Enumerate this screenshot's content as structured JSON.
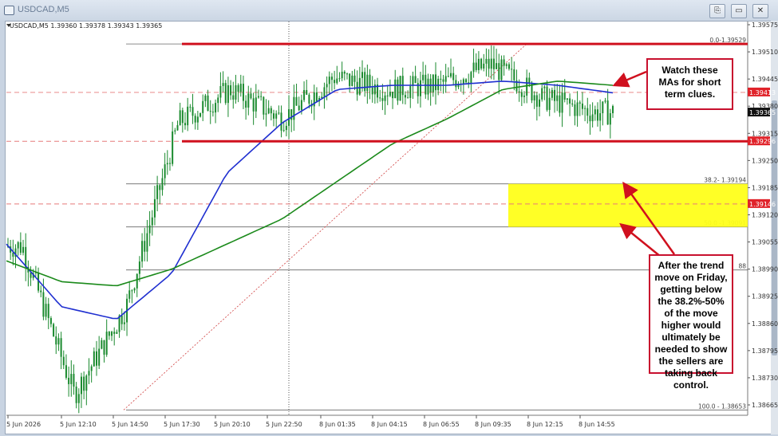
{
  "window": {
    "title": "USDCAD,M5",
    "buttons": [
      "⎘",
      "▭",
      "✕"
    ]
  },
  "symbol_info": "USDCAD,M5  1.39360 1.39378 1.39343 1.39365",
  "price_axis": {
    "ticks": [
      "1.39575",
      "1.39510",
      "1.39445",
      "1.39380",
      "1.39315",
      "1.39250",
      "1.39185",
      "1.39120",
      "1.39055",
      "1.38990",
      "1.38925",
      "1.38860",
      "1.38795",
      "1.38730",
      "1.38665"
    ],
    "tick_values": [
      1.39575,
      1.3951,
      1.39445,
      1.3938,
      1.39315,
      1.3925,
      1.39185,
      1.3912,
      1.39055,
      1.3899,
      1.38925,
      1.3886,
      1.38795,
      1.3873,
      1.38665
    ],
    "markers": [
      {
        "label": "1.39413",
        "value": 1.39413,
        "color": "#e0232a"
      },
      {
        "label": "1.39365",
        "value": 1.39365,
        "color": "#111111"
      },
      {
        "label": "1.39296",
        "value": 1.39296,
        "color": "#e0232a"
      },
      {
        "label": "1.39146",
        "value": 1.39146,
        "color": "#e0232a"
      }
    ]
  },
  "time_axis": {
    "labels": [
      "5 Jun 2026",
      "5 Jun 12:10",
      "5 Jun 14:50",
      "5 Jun 17:30",
      "5 Jun 20:10",
      "5 Jun 22:50",
      "8 Jun 01:35",
      "8 Jun 04:15",
      "8 Jun 06:55",
      "8 Jun 09:35",
      "8 Jun 12:15",
      "8 Jun 14:55"
    ]
  },
  "fibonacci": [
    {
      "label": "0.0-1.39529",
      "value": 1.39529
    },
    {
      "label": "38.2- 1.39194",
      "value": 1.39194
    },
    {
      "label": "50.0 -1.39091",
      "value": 1.39091
    },
    {
      "label": "88",
      "value": 1.38988
    },
    {
      "label": "100.0 - 1.38653",
      "value": 1.38653
    }
  ],
  "annotations": {
    "ma_note": "Watch these MAs for short term clues.",
    "fib_note": "After the trend move on Friday, getting below the 38.2%-50% of the move higher would ultimately be needed to show the sellers are taking back control."
  },
  "colors": {
    "candle": "#1a8a2e",
    "ma_blue": "#1f2fd0",
    "ma_green": "#1b8a1b",
    "resistance": "#d0101e",
    "zone": "#ffff1a"
  },
  "chart_data": {
    "type": "line",
    "title": "",
    "xlabel": "",
    "ylabel": "",
    "ylim": [
      1.3864,
      1.396
    ],
    "x": [
      "5 Jun 2026",
      "5 Jun 12:10",
      "5 Jun 14:50",
      "5 Jun 17:30",
      "5 Jun 20:10",
      "5 Jun 22:50",
      "8 Jun 01:35",
      "8 Jun 04:15",
      "8 Jun 06:55",
      "8 Jun 09:35",
      "8 Jun 12:15",
      "8 Jun 14:55"
    ],
    "series": [
      {
        "values": [
          1.39045,
          1.3869,
          1.389,
          1.3934,
          1.3942,
          1.3935,
          1.3945,
          1.3942,
          1.3943,
          1.3948,
          1.394,
          1.39365
        ]
      },
      {
        "values": [
          1.3905,
          1.389,
          1.3887,
          1.3898,
          1.3922,
          1.3934,
          1.3942,
          1.3943,
          1.3943,
          1.3944,
          1.3943,
          1.39412
        ]
      },
      {
        "values": [
          1.3901,
          1.3896,
          1.3895,
          1.3899,
          1.3905,
          1.3911,
          1.392,
          1.3929,
          1.3935,
          1.3942,
          1.3944,
          1.3943
        ]
      }
    ],
    "levels": [
      {
        "label": "1.39529",
        "value": 1.39529
      },
      {
        "label": "1.39296",
        "value": 1.39296
      }
    ],
    "zone": [
      1.39091,
      1.39194
    ]
  }
}
